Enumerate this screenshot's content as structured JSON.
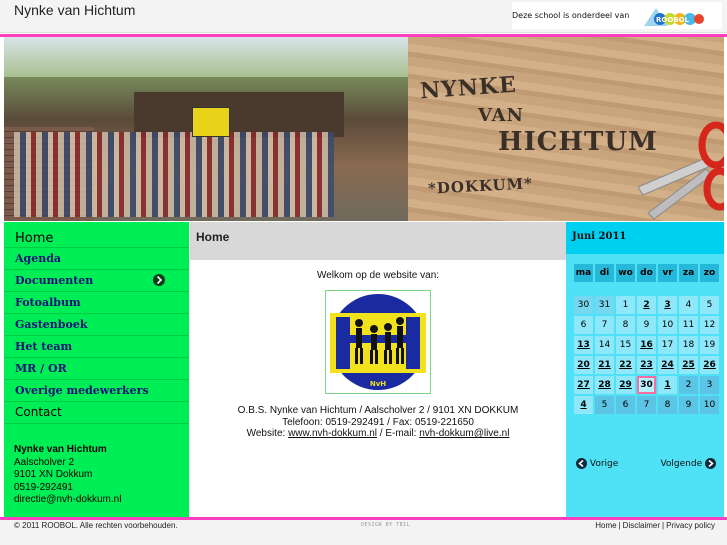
{
  "site": {
    "title": "Nynke van Hichtum",
    "koepel_text": "Deze school is onderdeel van",
    "roobol_logo_text": "ROOBOL"
  },
  "banner": {
    "wood_lines": [
      "NYNKE",
      "VAN",
      "HICHTUM",
      "*DOKKUM*"
    ],
    "flag_text": "NVH"
  },
  "menu": {
    "items": [
      {
        "label": "Home",
        "style": "home"
      },
      {
        "label": "Agenda",
        "style": "serif"
      },
      {
        "label": "Documenten",
        "style": "serif",
        "has_submenu": true
      },
      {
        "label": "Fotoalbum",
        "style": "serif"
      },
      {
        "label": "Gastenboek",
        "style": "serif"
      },
      {
        "label": "Het team",
        "style": "serif"
      },
      {
        "label": "MR / OR",
        "style": "serif"
      },
      {
        "label": "Overige medewerkers",
        "style": "serif"
      },
      {
        "label": "Contact",
        "style": "contact"
      }
    ]
  },
  "address": {
    "name": "Nynke van Hichtum",
    "street": "Aalscholver 2",
    "city": "9101 XN Dokkum",
    "phone": "0519-292491",
    "email": "directie@nvh-dokkum.nl"
  },
  "content": {
    "title": "Home",
    "welcome": "Welkom op de website van:",
    "logo_text": "NvH",
    "line1": "O.B.S. Nynke van Hichtum / Aalscholver 2 / 9101 XN  DOKKUM",
    "line2": "Telefoon: 0519-292491  /  Fax: 0519-221650",
    "line3_prefix": "Website: ",
    "website": "www.nvh-dokkum.nl",
    "line3_mid": " / E-mail: ",
    "email": "nvh-dokkum@live.nl"
  },
  "calendar": {
    "title": "Juni 2011",
    "weekdays": [
      "ma",
      "di",
      "wo",
      "do",
      "vr",
      "za",
      "zo"
    ],
    "weeks": [
      [
        {
          "d": "30",
          "t": "other"
        },
        {
          "d": "31",
          "t": "other"
        },
        {
          "d": "1",
          "t": "norm"
        },
        {
          "d": "2",
          "t": "link"
        },
        {
          "d": "3",
          "t": "link"
        },
        {
          "d": "4",
          "t": "norm"
        },
        {
          "d": "5",
          "t": "norm"
        }
      ],
      [
        {
          "d": "6",
          "t": "norm"
        },
        {
          "d": "7",
          "t": "norm"
        },
        {
          "d": "8",
          "t": "norm"
        },
        {
          "d": "9",
          "t": "norm"
        },
        {
          "d": "10",
          "t": "norm"
        },
        {
          "d": "11",
          "t": "norm"
        },
        {
          "d": "12",
          "t": "norm"
        }
      ],
      [
        {
          "d": "13",
          "t": "link"
        },
        {
          "d": "14",
          "t": "norm"
        },
        {
          "d": "15",
          "t": "norm"
        },
        {
          "d": "16",
          "t": "link"
        },
        {
          "d": "17",
          "t": "norm"
        },
        {
          "d": "18",
          "t": "norm"
        },
        {
          "d": "19",
          "t": "norm"
        }
      ],
      [
        {
          "d": "20",
          "t": "link"
        },
        {
          "d": "21",
          "t": "link"
        },
        {
          "d": "22",
          "t": "link"
        },
        {
          "d": "23",
          "t": "link"
        },
        {
          "d": "24",
          "t": "link"
        },
        {
          "d": "25",
          "t": "link"
        },
        {
          "d": "26",
          "t": "link"
        }
      ],
      [
        {
          "d": "27",
          "t": "link"
        },
        {
          "d": "28",
          "t": "link"
        },
        {
          "d": "29",
          "t": "link"
        },
        {
          "d": "30",
          "t": "today"
        },
        {
          "d": "1",
          "t": "link"
        },
        {
          "d": "2",
          "t": "next"
        },
        {
          "d": "3",
          "t": "next"
        }
      ],
      [
        {
          "d": "4",
          "t": "link"
        },
        {
          "d": "5",
          "t": "next"
        },
        {
          "d": "6",
          "t": "next"
        },
        {
          "d": "7",
          "t": "next"
        },
        {
          "d": "8",
          "t": "next"
        },
        {
          "d": "9",
          "t": "next"
        },
        {
          "d": "10",
          "t": "next"
        }
      ]
    ],
    "prev_label": "Vorige",
    "next_label": "Volgende"
  },
  "footer": {
    "copyright": "© 2011 ROOBOL. Alle rechten voorbehouden.",
    "credit": "DESIGN BY TBIL",
    "links": [
      "Home",
      "Disclaimer",
      "Privacy policy"
    ]
  },
  "colors": {
    "accent_pink": "#ff3ec0",
    "menu_green": "#00ee55",
    "calendar_cyan": "#32e8ff"
  }
}
